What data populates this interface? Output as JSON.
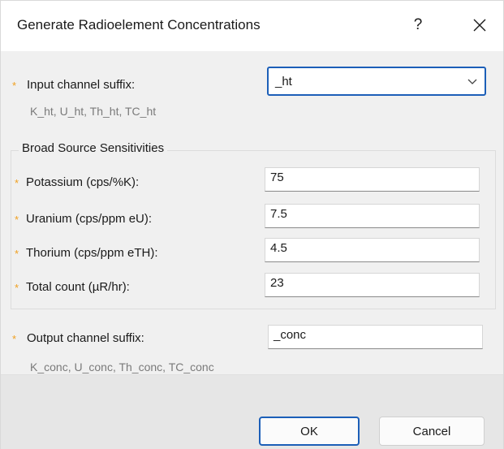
{
  "dialog": {
    "title": "Generate Radioelement Concentrations",
    "help_glyph": "?",
    "close_icon": "close-icon"
  },
  "input": {
    "label": "Input channel suffix:",
    "value": "_ht",
    "hint": "K_ht, U_ht, Th_ht, TC_ht"
  },
  "group": {
    "title": "Broad Source Sensitivities",
    "fields": [
      {
        "label": "Potassium (cps/%K):",
        "value": "75"
      },
      {
        "label": "Uranium (cps/ppm eU):",
        "value": "7.5"
      },
      {
        "label": "Thorium (cps/ppm eTH):",
        "value": "4.5"
      },
      {
        "label": "Total count (µR/hr):",
        "value": "23"
      }
    ]
  },
  "output": {
    "label": "Output channel suffix:",
    "value": "_conc",
    "hint": "K_conc, U_conc, Th_conc, TC_conc"
  },
  "buttons": {
    "ok": "OK",
    "cancel": "Cancel"
  },
  "required_marker": "*",
  "colors": {
    "accent": "#1c5fb8",
    "required": "#f0a020",
    "hint": "#7a7a7a",
    "footer": "#e6e6e6"
  }
}
